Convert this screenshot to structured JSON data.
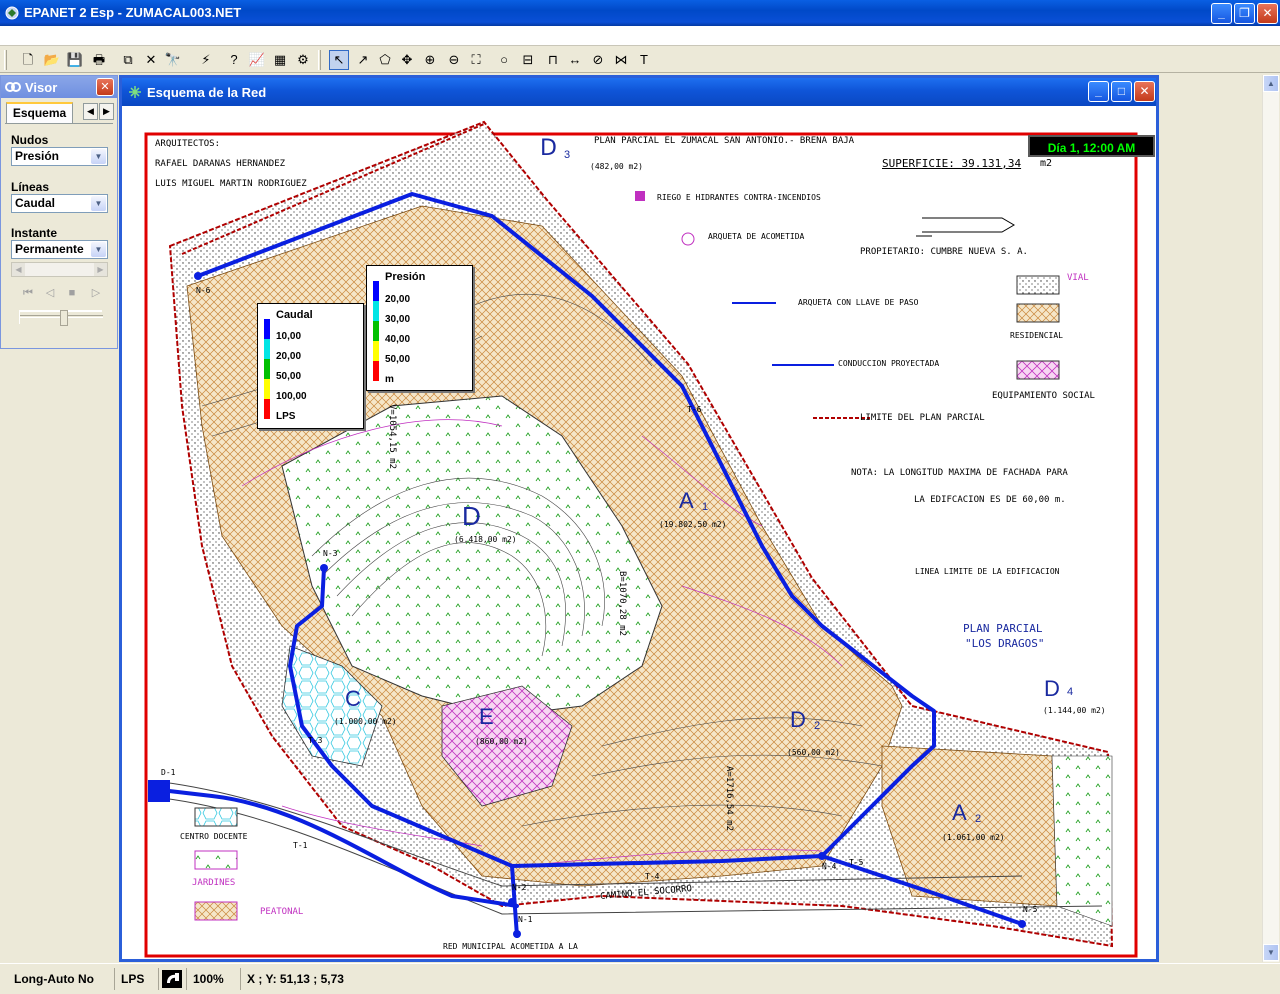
{
  "app": {
    "title": "EPANET 2 Esp - ZUMACAL003.NET",
    "minimize": "_",
    "restore": "❐",
    "close": "✕"
  },
  "toolbar": {
    "buttons": [
      {
        "name": "new-icon",
        "glyph": "🗋"
      },
      {
        "name": "open-icon",
        "glyph": "📂"
      },
      {
        "name": "save-icon",
        "glyph": "💾"
      },
      {
        "name": "print-icon",
        "glyph": "🖶"
      },
      {
        "name": "copy-icon",
        "glyph": "⧉"
      },
      {
        "name": "delete-icon",
        "glyph": "✕"
      },
      {
        "name": "find-icon",
        "glyph": "🔭"
      },
      {
        "name": "run-icon",
        "glyph": "⚡"
      },
      {
        "name": "query-icon",
        "glyph": "?"
      },
      {
        "name": "graph-icon",
        "glyph": "📈"
      },
      {
        "name": "table-icon",
        "glyph": "▦"
      },
      {
        "name": "options-icon",
        "glyph": "⚙"
      },
      {
        "name": "select-object-icon",
        "glyph": "↖"
      },
      {
        "name": "select-vertex-icon",
        "glyph": "↗"
      },
      {
        "name": "select-region-icon",
        "glyph": "⬠"
      },
      {
        "name": "pan-icon",
        "glyph": "✥"
      },
      {
        "name": "zoom-in-icon",
        "glyph": "⊕"
      },
      {
        "name": "zoom-out-icon",
        "glyph": "⊖"
      },
      {
        "name": "full-extent-icon",
        "glyph": "⛶"
      },
      {
        "name": "add-junction-icon",
        "glyph": "○"
      },
      {
        "name": "add-reservoir-icon",
        "glyph": "⊟"
      },
      {
        "name": "add-tank-icon",
        "glyph": "⊓"
      },
      {
        "name": "add-pipe-icon",
        "glyph": "↔"
      },
      {
        "name": "add-pump-icon",
        "glyph": "⊘"
      },
      {
        "name": "add-valve-icon",
        "glyph": "⋈"
      },
      {
        "name": "add-label-icon",
        "glyph": "T"
      }
    ]
  },
  "visor": {
    "title": "Visor",
    "tab": "Esquema",
    "nodes_label": "Nudos",
    "nodes_value": "Presión",
    "links_label": "Líneas",
    "links_value": "Caudal",
    "time_label": "Instante",
    "time_value": "Permanente"
  },
  "map_window": {
    "title": "Esquema de la Red",
    "day": "Día 1, 12:00 AM"
  },
  "legend_caudal": {
    "title": "Caudal",
    "values": [
      "10,00",
      "20,00",
      "50,00",
      "100,00"
    ],
    "unit": "LPS",
    "colors": [
      "#0000ff",
      "#00e5e5",
      "#00c000",
      "#ffff00",
      "#ff0000"
    ]
  },
  "legend_presion": {
    "title": "Presión",
    "values": [
      "20,00",
      "30,00",
      "40,00",
      "50,00"
    ],
    "unit": "m",
    "colors": [
      "#0000ff",
      "#00e5e5",
      "#00c000",
      "#ffff00",
      "#ff0000"
    ]
  },
  "drawing": {
    "architects_label": "ARQUITECTOS:",
    "architect1": "RAFAEL DARANAS HERNANDEZ",
    "architect2": "LUIS MIGUEL MARTIN RODRIGUEZ",
    "plan_title": "PLAN PARCIAL EL ZUMACAL SAN ANTONIO.- BRENA BAJA",
    "surface": "SUPERFICIE: 39.131,34",
    "surface_unit": "m2",
    "owner": "PROPIETARIO: CUMBRE NUEVA S. A.",
    "legend_riego": "RIEGO E HIDRANTES CONTRA-INCENDIOS",
    "legend_arqueta": "ARQUETA DE ACOMETIDA",
    "legend_llave": "ARQUETA CON LLAVE DE PASO",
    "legend_conduccion": "CONDUCCION PROYECTADA",
    "legend_limite": "LIMITE DEL PLAN PARCIAL",
    "vial": "VIAL",
    "residencial": "RESIDENCIAL",
    "equipamiento": "EQUIPAMIENTO SOCIAL",
    "nota1": "NOTA:   LA LONGITUD MAXIMA DE FACHADA PARA",
    "nota2": "LA EDIFCACION ES DE 60,00 m.",
    "linea_limite": "LINEA LIMITE DE LA EDIFICACION",
    "plan_dragos1": "PLAN PARCIAL",
    "plan_dragos2": "\"LOS DRAGOS\"",
    "centro_docente": "CENTRO DOCENTE",
    "jardines": "JARDINES",
    "peatonal": "PEATONAL",
    "camino": "CAMINO EL SOCORRO",
    "red_municipal": "RED MUNICIPAL   ACOMETIDA A LA",
    "zone_d3": "D",
    "zone_d3_sub": "3",
    "zone_d3_area": "(482,00 m2)",
    "zone_d4": "D",
    "zone_d4_sub": "4",
    "zone_d4_area": "(1.144,00 m2)",
    "zone_d1": "D",
    "zone_d1_area": "(6.418,00 m2)",
    "zone_a1": "A",
    "zone_a1_sub": "1",
    "zone_a1_area": "(19.802,50 m2)",
    "zone_d2": "D",
    "zone_d2_sub": "2",
    "zone_d2_area": "(560,00 m2)",
    "zone_a2": "A",
    "zone_a2_sub": "2",
    "zone_a2_area": "(1.061,00 m2)",
    "zone_c": "C",
    "zone_c_area": "(1.000,00 m2)",
    "zone_e": "E",
    "zone_e_area": "(860,00 m2)",
    "dim_a1": "A=1716,54 m2",
    "dim_b": "B=1070,28 m2",
    "dim_v": "V=1054,15 m2",
    "nodes": [
      "N-6",
      "N-3",
      "N-2",
      "N-1",
      "N-4",
      "N-5",
      "D-1"
    ],
    "pipes": [
      "T-6",
      "T-3",
      "T-1",
      "T-4",
      "T-5"
    ]
  },
  "status": {
    "autolength": "Long-Auto No",
    "units": "LPS",
    "zoom": "100%",
    "coords": "X ; Y: 51,13 ;  5,73"
  }
}
